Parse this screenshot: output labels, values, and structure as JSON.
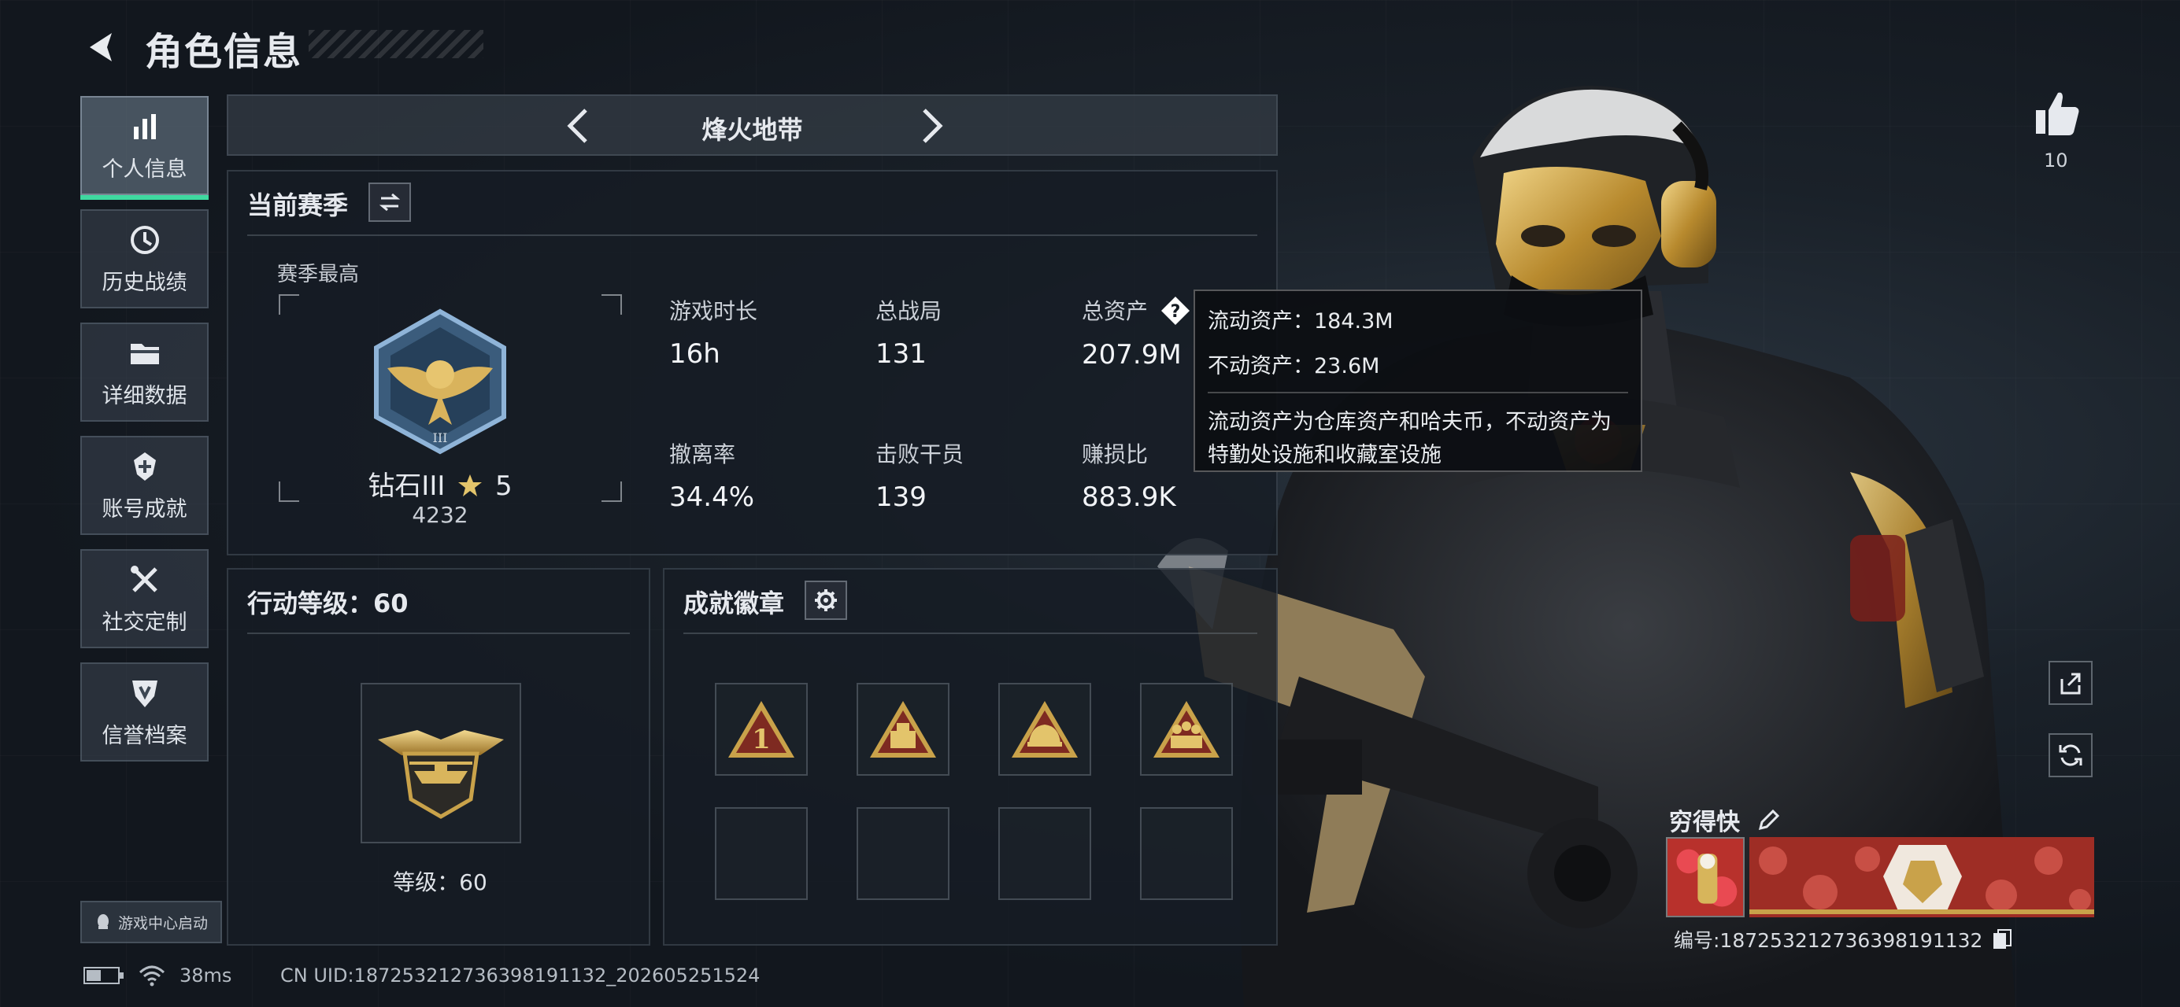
{
  "header": {
    "title": "角色信息"
  },
  "sidebar": {
    "items": [
      {
        "label": "个人信息",
        "icon": "bar-chart-icon",
        "active": true
      },
      {
        "label": "历史战绩",
        "icon": "history-icon"
      },
      {
        "label": "详细数据",
        "icon": "folder-icon"
      },
      {
        "label": "账号成就",
        "icon": "achievement-icon"
      },
      {
        "label": "社交定制",
        "icon": "tools-icon"
      },
      {
        "label": "信誉档案",
        "icon": "shield-icon"
      }
    ],
    "game_center_label": "游戏中心启动"
  },
  "mode": {
    "title": "烽火地带"
  },
  "season": {
    "title": "当前赛季",
    "best_label": "赛季最高",
    "rank_name": "钻石III",
    "rank_stars": "5",
    "rank_score": "4232",
    "stats": [
      {
        "label": "游戏时长",
        "value": "16h"
      },
      {
        "label": "总战局",
        "value": "131"
      },
      {
        "label": "总资产",
        "value": "207.9M"
      },
      {
        "label": "撤离率",
        "value": "34.4%"
      },
      {
        "label": "击败干员",
        "value": "139"
      },
      {
        "label": "赚损比",
        "value": "883.9K"
      }
    ]
  },
  "tooltip": {
    "liquid": "流动资产：184.3M",
    "fixed": "不动资产：23.6M",
    "description": "流动资产为仓库资产和哈夫币，不动资产为特勤处设施和收藏室设施"
  },
  "action_level": {
    "title": "行动等级：60",
    "level_label": "等级：60"
  },
  "badges": {
    "title": "成就徽章",
    "items": [
      "badge-1-icon",
      "badge-crate-icon",
      "badge-helmet-icon",
      "badge-squad-icon"
    ]
  },
  "profile": {
    "likes": "10",
    "name": "穷得快",
    "id_text": "编号:18725321273639819113​2"
  },
  "status": {
    "ping": "38ms",
    "uid": "CN UID:18725321273639819113​2_202605251524"
  },
  "colors": {
    "accent": "#3fd9a0",
    "gold": "#c9a24a",
    "badge_red": "#8c2a22"
  }
}
